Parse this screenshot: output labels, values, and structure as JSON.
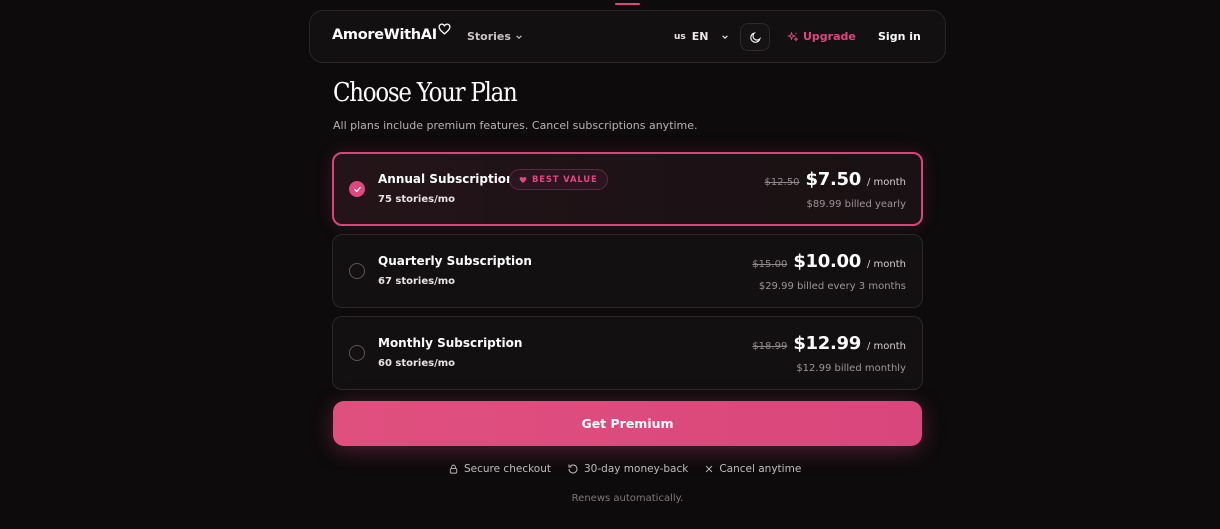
{
  "header": {
    "logo_text": "AmoreWithAI",
    "nav_stories": "Stories",
    "lang_flag": "us",
    "lang_code": "EN",
    "upgrade_label": "Upgrade",
    "signin_label": "Sign in"
  },
  "main": {
    "title": "Choose Your Plan",
    "subtitle": "All plans include premium features. Cancel subscriptions anytime.",
    "plans": [
      {
        "name": "Annual Subscription",
        "badge": "BEST VALUE",
        "stories": "75 stories/mo",
        "old_price": "$12.50",
        "price": "$7.50",
        "period": "/ month",
        "billing": "$89.99 billed yearly",
        "selected": true
      },
      {
        "name": "Quarterly Subscription",
        "stories": "67 stories/mo",
        "old_price": "$15.00",
        "price": "$10.00",
        "period": "/ month",
        "billing": "$29.99 billed every 3 months",
        "selected": false
      },
      {
        "name": "Monthly Subscription",
        "stories": "60 stories/mo",
        "old_price": "$18.99",
        "price": "$12.99",
        "period": "/ month",
        "billing": "$12.99 billed monthly",
        "selected": false
      }
    ],
    "cta_label": "Get Premium",
    "assurances": {
      "secure": "Secure checkout",
      "money_back": "30-day money-back",
      "cancel": "Cancel anytime"
    },
    "footnote": "Renews automatically."
  },
  "colors": {
    "accent": "#e0477e",
    "background": "#0d0b0c",
    "card": "#121011"
  }
}
